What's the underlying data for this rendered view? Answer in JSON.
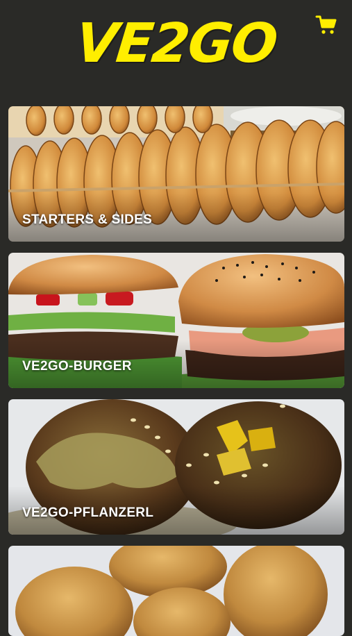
{
  "app": {
    "logo_text": "VE2GO",
    "accent_color": "#ffee00",
    "background_color": "#2a2a27",
    "cart_icon": "cart-icon"
  },
  "categories": [
    {
      "label": "STARTERS & SIDES",
      "image": "spiral-potato-image"
    },
    {
      "label": "VE2GO-BURGER",
      "image": "burger-image"
    },
    {
      "label": "VE2GO-PFLANZERL",
      "image": "pflanzerl-image"
    },
    {
      "label": "",
      "image": "breaded-nuggets-image"
    }
  ]
}
